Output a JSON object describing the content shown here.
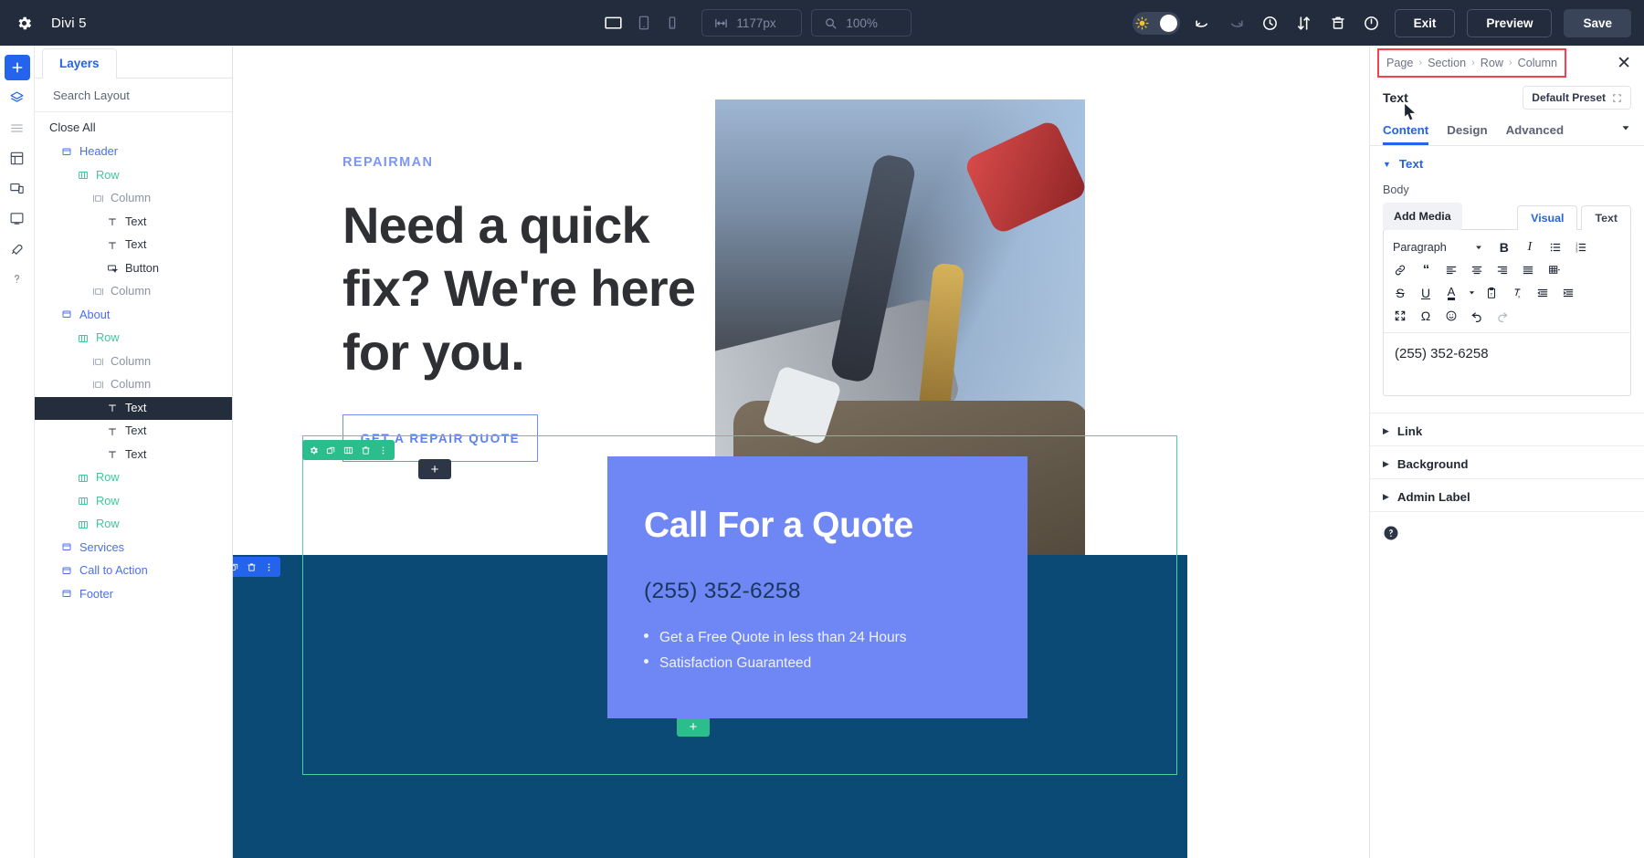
{
  "topbar": {
    "gear_icon": "gear-icon",
    "app_title": "Divi 5",
    "viewports": [
      {
        "name": "desktop",
        "icon": "desktop-icon",
        "active": true
      },
      {
        "name": "tablet",
        "icon": "tablet-icon",
        "active": false
      },
      {
        "name": "phone",
        "icon": "phone-icon",
        "active": false
      }
    ],
    "width_value": "1177px",
    "width_icon": "horizontal-resize-icon",
    "zoom_value": "100%",
    "zoom_icon": "magnifier-icon",
    "theme_toggle_icon": "sun-icon",
    "undo_icon": "undo-icon",
    "redo_icon": "redo-icon",
    "history_icon": "clock-history-icon",
    "sort_icon": "sort-updown-icon",
    "trash_icon": "trash-icon",
    "power_icon": "power-icon",
    "exit_label": "Exit",
    "preview_label": "Preview",
    "save_label": "Save",
    "bg_color": "#232c3d"
  },
  "rail": {
    "items": [
      {
        "icon": "plus-icon",
        "name": "add-module",
        "primary": true
      },
      {
        "icon": "layers-icon",
        "name": "layers"
      },
      {
        "icon": "list-icon",
        "name": "list-view"
      },
      {
        "icon": "wireframe-icon",
        "name": "wireframe"
      },
      {
        "icon": "responsive-icon",
        "name": "responsive-view"
      },
      {
        "icon": "portability-icon",
        "name": "portability"
      },
      {
        "icon": "tools-icon",
        "name": "tools"
      },
      {
        "icon": "help-icon",
        "name": "help"
      }
    ]
  },
  "layers": {
    "tab_label": "Layers",
    "search_placeholder": "Search Layout",
    "search_value": "",
    "search_icon": "search-icon",
    "filter_icon": "filter-icon",
    "close_all_label": "Close All",
    "tree": [
      {
        "label": "Header",
        "type": "section",
        "indent": 0,
        "icon": "section-icon",
        "selected": false
      },
      {
        "label": "Row",
        "type": "row",
        "indent": 1,
        "icon": "row-icon",
        "selected": false
      },
      {
        "label": "Column",
        "type": "column",
        "indent": 2,
        "icon": "column-icon",
        "selected": false
      },
      {
        "label": "Text",
        "type": "module",
        "indent": 3,
        "icon": "text-icon",
        "selected": false
      },
      {
        "label": "Text",
        "type": "module",
        "indent": 3,
        "icon": "text-icon",
        "selected": false
      },
      {
        "label": "Button",
        "type": "module",
        "indent": 3,
        "icon": "button-icon",
        "selected": false
      },
      {
        "label": "Column",
        "type": "column",
        "indent": 2,
        "icon": "column-icon",
        "selected": false
      },
      {
        "label": "About",
        "type": "section",
        "indent": 0,
        "icon": "section-icon",
        "selected": false
      },
      {
        "label": "Row",
        "type": "row",
        "indent": 1,
        "icon": "row-icon",
        "selected": false
      },
      {
        "label": "Column",
        "type": "column",
        "indent": 2,
        "icon": "column-icon",
        "selected": false
      },
      {
        "label": "Column",
        "type": "column",
        "indent": 2,
        "icon": "column-icon",
        "selected": false
      },
      {
        "label": "Text",
        "type": "module",
        "indent": 3,
        "icon": "text-icon",
        "selected": true
      },
      {
        "label": "Text",
        "type": "module",
        "indent": 3,
        "icon": "text-icon",
        "selected": false
      },
      {
        "label": "Text",
        "type": "module",
        "indent": 3,
        "icon": "text-icon",
        "selected": false
      },
      {
        "label": "Row",
        "type": "row",
        "indent": 1,
        "icon": "row-icon",
        "selected": false
      },
      {
        "label": "Row",
        "type": "row",
        "indent": 1,
        "icon": "row-icon",
        "selected": false
      },
      {
        "label": "Row",
        "type": "row",
        "indent": 1,
        "icon": "row-icon",
        "selected": false
      },
      {
        "label": "Services",
        "type": "section",
        "indent": 0,
        "icon": "section-icon",
        "selected": false
      },
      {
        "label": "Call to Action",
        "type": "section",
        "indent": 0,
        "icon": "section-icon",
        "selected": false
      },
      {
        "label": "Footer",
        "type": "section",
        "indent": 0,
        "icon": "section-icon",
        "selected": false
      }
    ]
  },
  "canvas": {
    "hero": {
      "eyebrow": "REPAIRMAN",
      "heading": "Need a quick fix? We're here for you.",
      "cta_label": "GET A REPAIR QUOTE",
      "photo_alt": "tool-belt-photo"
    },
    "quote_card": {
      "title": "Call For a Quote",
      "phone": "(255) 352-6258",
      "bullets": [
        "Get a Free Quote in less than 24 Hours",
        "Satisfaction Guaranteed"
      ],
      "bg_color": "#6f87f5"
    },
    "row_toolbar_icons": [
      "settings-icon",
      "duplicate-icon",
      "columns-icon",
      "delete-icon",
      "more-icon"
    ],
    "section_toolbar_icons": [
      "settings-icon",
      "duplicate-icon",
      "delete-icon",
      "more-icon"
    ],
    "add_module_label": "+",
    "add_row_label": "+",
    "band_color": "#0c4a76"
  },
  "rightpanel": {
    "breadcrumb": [
      "Page",
      "Section",
      "Row",
      "Column"
    ],
    "breadcrumb_sep": "›",
    "close_icon": "close-icon",
    "module_name": "Text",
    "preset_label": "Default Preset",
    "preset_icon": "preset-icon",
    "tabs": [
      {
        "label": "Content",
        "active": true
      },
      {
        "label": "Design",
        "active": false
      },
      {
        "label": "Advanced",
        "active": false
      }
    ],
    "tab_caret_icon": "chevron-down-icon",
    "sections": [
      {
        "label": "Text",
        "open": true
      },
      {
        "label": "Link",
        "open": false
      },
      {
        "label": "Background",
        "open": false
      },
      {
        "label": "Admin Label",
        "open": false
      }
    ],
    "body_label": "Body",
    "add_media_label": "Add Media",
    "editor_tabs": [
      {
        "label": "Visual",
        "active": true
      },
      {
        "label": "Text",
        "active": false
      }
    ],
    "format_select_value": "Paragraph",
    "editor_content": "(255) 352-6258",
    "toolbar_rows": [
      [
        "bold-icon",
        "italic-icon",
        "bulleted-list-icon",
        "numbered-list-icon"
      ],
      [
        "link-icon",
        "blockquote-icon",
        "align-left-icon",
        "align-center-icon",
        "align-right-icon",
        "align-justify-icon",
        "table-icon"
      ],
      [
        "strikethrough-icon",
        "underline-icon",
        "text-color-icon",
        "paste-as-text-icon",
        "clear-formatting-icon",
        "outdent-icon",
        "indent-icon"
      ],
      [
        "fullscreen-icon",
        "special-character-icon",
        "emoji-icon",
        "undo-icon",
        "redo-icon"
      ]
    ],
    "help_icon": "help-circle-icon",
    "accent_color": "#2463eb",
    "highlight_color": "#f4414d"
  }
}
